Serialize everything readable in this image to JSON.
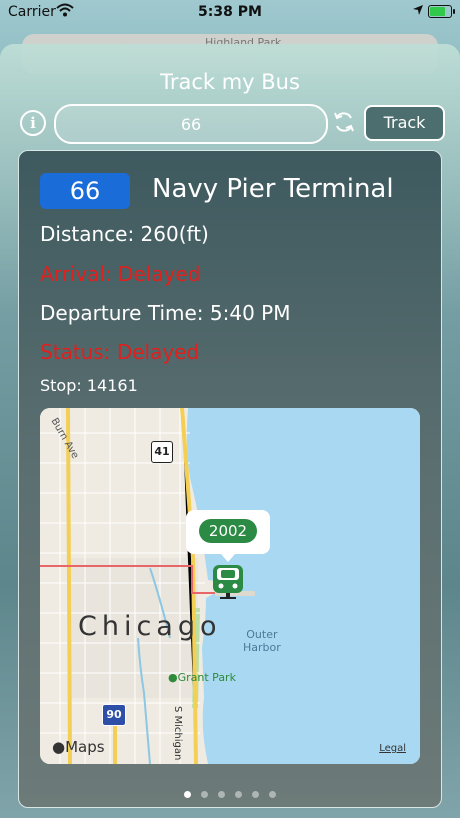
{
  "status_bar": {
    "carrier": "Carrier",
    "time": "5:38 PM"
  },
  "background_card": {
    "text": "Highland Park"
  },
  "header": {
    "title": "Track my Bus",
    "info_icon": "info-icon",
    "refresh_icon": "refresh-icon",
    "track_label": "Track"
  },
  "search": {
    "value": "66"
  },
  "details": {
    "route_number": "66",
    "stop_name": "Navy Pier Terminal",
    "distance": "Distance: 260(ft)",
    "arrival": "Arrival: Delayed",
    "departure": "Departure Time: 5:40 PM",
    "status": "Status: Delayed",
    "stop_id": "Stop: 14161"
  },
  "map": {
    "city_label": "Chicago",
    "harbor_label_1": "Outer",
    "harbor_label_2": "Harbor",
    "park_label": "Grant Park",
    "street_label": "S Michigan",
    "avenue_label": "Burn Ave",
    "highway_41": "41",
    "highway_90": "90",
    "bus_vehicle": "2002",
    "attribution": "Maps",
    "legal": "Legal"
  },
  "pager": {
    "count": 6,
    "active": 1
  },
  "colors": {
    "accent_blue": "#1a6cd9",
    "delay_red": "#e0201c",
    "bus_green": "#2b8a43"
  }
}
